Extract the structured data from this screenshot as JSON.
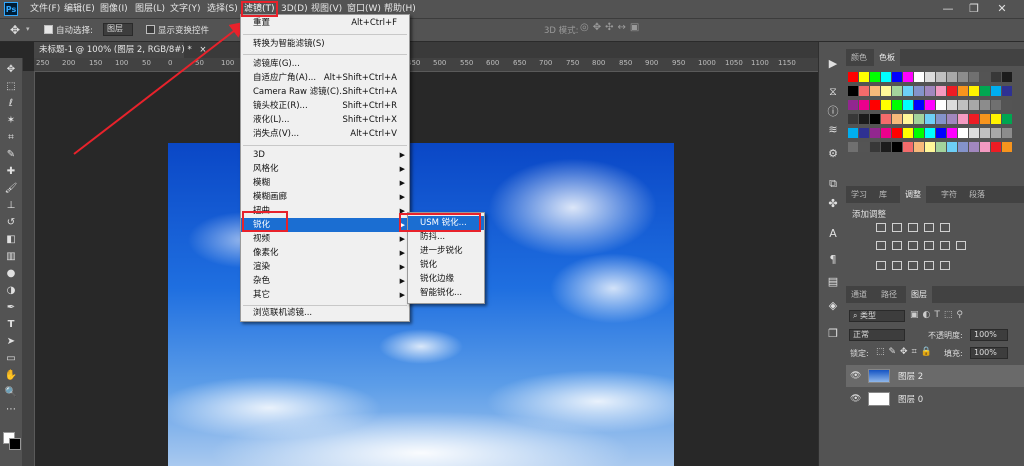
{
  "menubar": {
    "logo": "Ps",
    "items": [
      "文件(F)",
      "编辑(E)",
      "图像(I)",
      "图层(L)",
      "文字(Y)",
      "选择(S)",
      "滤镜(T)",
      "3D(D)",
      "视图(V)",
      "窗口(W)",
      "帮助(H)"
    ],
    "window_buttons": [
      "—",
      "❐",
      "✕"
    ]
  },
  "options_bar": {
    "auto_select_label": "自动选择:",
    "auto_select_value": "图层",
    "show_transform_label": "显示变换控件",
    "mode_3d_label": "3D 模式:"
  },
  "document_tab": {
    "title": "未标题-1 @ 100% (图层 2, RGB/8#) *",
    "close": "×"
  },
  "ruler": {
    "h_ticks": [
      "250",
      "200",
      "150",
      "100",
      "50",
      "0",
      "50",
      "100",
      "150",
      "200",
      "250",
      "300",
      "350",
      "400",
      "450",
      "500",
      "550",
      "600",
      "650",
      "700",
      "750",
      "800",
      "850",
      "900",
      "950",
      "1000",
      "1050",
      "1100",
      "1150"
    ]
  },
  "filter_menu": {
    "items": [
      {
        "label": "重置",
        "shortcut": "Alt+Ctrl+F"
      },
      {
        "label": "转换为智能滤镜(S)",
        "shortcut": ""
      },
      {
        "label": "滤镜库(G)...",
        "shortcut": ""
      },
      {
        "label": "自适应广角(A)...",
        "shortcut": "Alt+Shift+Ctrl+A"
      },
      {
        "label": "Camera Raw 滤镜(C)...",
        "shortcut": "Shift+Ctrl+A"
      },
      {
        "label": "镜头校正(R)...",
        "shortcut": "Shift+Ctrl+R"
      },
      {
        "label": "液化(L)...",
        "shortcut": "Shift+Ctrl+X"
      },
      {
        "label": "消失点(V)...",
        "shortcut": "Alt+Ctrl+V"
      },
      {
        "label": "3D",
        "shortcut": ""
      },
      {
        "label": "风格化",
        "shortcut": ""
      },
      {
        "label": "模糊",
        "shortcut": ""
      },
      {
        "label": "模糊画廊",
        "shortcut": ""
      },
      {
        "label": "扭曲",
        "shortcut": ""
      },
      {
        "label": "锐化",
        "shortcut": ""
      },
      {
        "label": "视频",
        "shortcut": ""
      },
      {
        "label": "像素化",
        "shortcut": ""
      },
      {
        "label": "渲染",
        "shortcut": ""
      },
      {
        "label": "杂色",
        "shortcut": ""
      },
      {
        "label": "其它",
        "shortcut": ""
      },
      {
        "label": "浏览联机滤镜...",
        "shortcut": ""
      }
    ]
  },
  "sharpen_submenu": {
    "items": [
      "USM 锐化...",
      "防抖...",
      "进一步锐化",
      "锐化",
      "锐化边缘",
      "智能锐化..."
    ]
  },
  "panels": {
    "swatch_tabs": [
      "颜色",
      "色板"
    ],
    "swatch_colors": [
      "#ff0000",
      "#ffff00",
      "#00ff00",
      "#00ffff",
      "#0000ff",
      "#ff00ff",
      "#ffffff",
      "#dcdcdc",
      "#c0c0c0",
      "#a8a8a8",
      "#8c8c8c",
      "#707070",
      "#545454",
      "#383838",
      "#1c1c1c",
      "#000000",
      "#f26b6b",
      "#f7b97a",
      "#fff799",
      "#a3d39c",
      "#6dcff6",
      "#8493ca",
      "#a187be",
      "#f49ac1",
      "#ed1c24",
      "#f7941d",
      "#fff200",
      "#00a651",
      "#00aeef",
      "#2e3192",
      "#92278f",
      "#ec008c"
    ],
    "adjust_tabs": [
      "学习",
      "库",
      "调整",
      "字符",
      "段落"
    ],
    "adjust_title": "添加调整",
    "layer_tabs": [
      "通道",
      "路径",
      "图层"
    ],
    "kind_label": "类型",
    "blend_mode": "正常",
    "opacity_label": "不透明度:",
    "opacity_value": "100%",
    "lock_label": "锁定:",
    "fill_label": "填充:",
    "fill_value": "100%",
    "layers": [
      {
        "name": "图层 2"
      },
      {
        "name": "图层 0"
      }
    ]
  },
  "colors": {
    "accent": "#1b6ed2",
    "annotation": "#e8222b"
  }
}
